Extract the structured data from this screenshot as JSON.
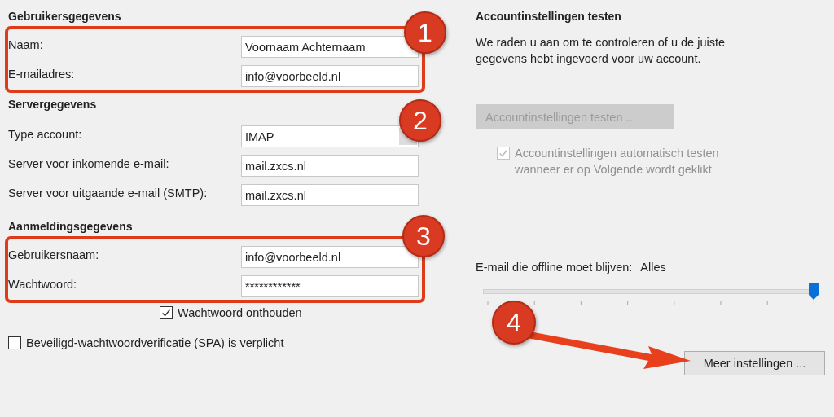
{
  "left": {
    "sections": [
      {
        "title": "Gebruikersgegevens",
        "highlighted": true,
        "badge": "1",
        "fields": [
          {
            "label": "Naam:",
            "value": "Voornaam Achternaam",
            "kind": "text"
          },
          {
            "label": "E-mailadres:",
            "value": "info@voorbeeld.nl",
            "kind": "text"
          }
        ]
      },
      {
        "title": "Servergegevens",
        "highlighted": false,
        "badge": "2",
        "fields": [
          {
            "label": "Type account:",
            "value": "IMAP",
            "kind": "dropdown"
          },
          {
            "label": "Server voor inkomende e-mail:",
            "value": "mail.zxcs.nl",
            "kind": "text"
          },
          {
            "label": "Server voor uitgaande e-mail (SMTP):",
            "value": "mail.zxcs.nl",
            "kind": "text"
          }
        ]
      },
      {
        "title": "Aanmeldingsgegevens",
        "highlighted": true,
        "badge": "3",
        "fields": [
          {
            "label": "Gebruikersnaam:",
            "value": "info@voorbeeld.nl",
            "kind": "text"
          },
          {
            "label": "Wachtwoord:",
            "value": "************",
            "kind": "password"
          }
        ]
      }
    ],
    "checkboxes": [
      {
        "label": "Wachtwoord onthouden",
        "checked": true
      },
      {
        "label": "Beveiligd-wachtwoordverificatie (SPA) is verplicht",
        "checked": false
      }
    ]
  },
  "right": {
    "title": "Accountinstellingen testen",
    "description": "We raden u aan om te controleren of u de juiste gegevens hebt ingevoerd voor uw account.",
    "test_button": {
      "label": "Accountinstellingen testen ...",
      "disabled": true
    },
    "auto_test": {
      "label": "Accountinstellingen automatisch testen wanneer er op Volgende wordt geklikt",
      "checked": true,
      "disabled": true
    },
    "offline": {
      "label": "E-mail die offline moet blijven:",
      "value": "Alles",
      "level": 1
    },
    "more_button": {
      "label": "Meer instellingen ...",
      "badge": "4"
    }
  }
}
